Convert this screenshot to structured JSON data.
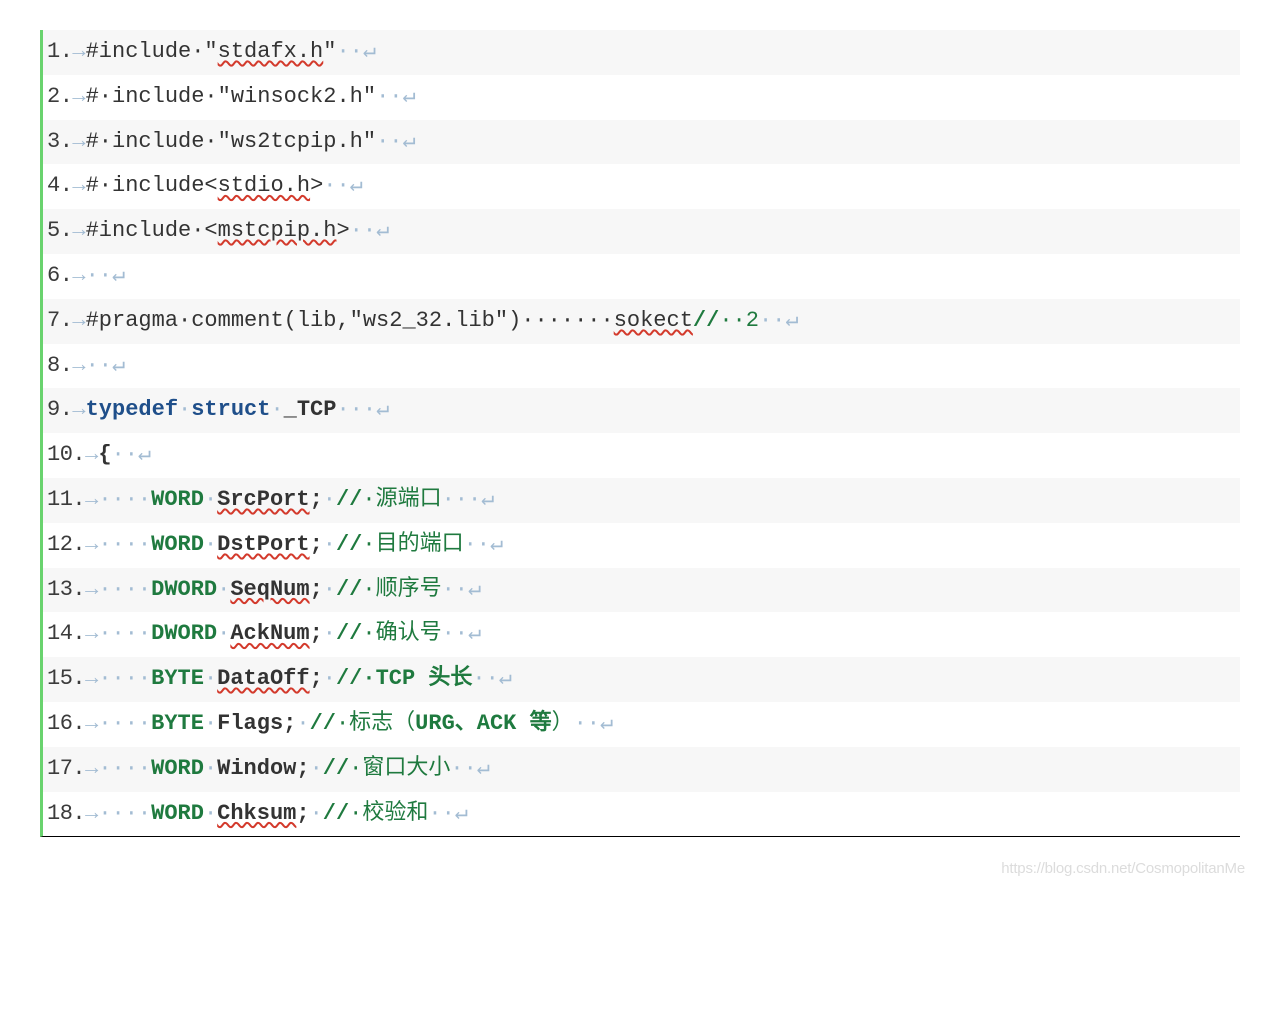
{
  "lines": [
    {
      "n": "1.",
      "tab": "→",
      "pre": "#include·\"",
      "squig": "stdafx.h",
      "post": "\"",
      "trail": "··↵"
    },
    {
      "n": "2.",
      "tab": "→",
      "pre": "#·include·\"winsock2.h\"",
      "trail": "··↵"
    },
    {
      "n": "3.",
      "tab": "→",
      "pre": "#·include·\"ws2tcpip.h\"",
      "trail": "··↵"
    },
    {
      "n": "4.",
      "tab": "→",
      "pre": "#·include<",
      "squig": "stdio.h",
      "post": ">",
      "trail": "··↵"
    },
    {
      "n": "5.",
      "tab": "→",
      "pre": "#include·<",
      "squig": "mstcpip.h",
      "post": ">",
      "trail": "··↵"
    },
    {
      "n": "6.",
      "tab": "→",
      "trail": "··↵"
    },
    {
      "n": "7.",
      "tab": "→",
      "pre": "#pragma·comment(lib,\"ws2_32.lib\")·······",
      "cmt": "//",
      "cmt2": "·",
      "squig": "sokect",
      "post2": "·2",
      "trail": "··↵"
    },
    {
      "n": "8.",
      "tab": "→",
      "trail": "··↵"
    },
    {
      "n": "9.",
      "tab": "→",
      "kw": "typedef",
      "dot1": "·",
      "kw2": "struct",
      "dot2": "·",
      "ident": "_TCP",
      "trail": "··↵"
    },
    {
      "n": "10.",
      "tab": "→",
      "brace": "{",
      "trail": "··↵"
    },
    {
      "n": "11.",
      "tab": "→",
      "dots": "····",
      "type": "WORD",
      "dot1": "·",
      "squig": "SrcPort",
      "semi": ";",
      "dot2": "·",
      "cmt": "//",
      "cmt2": "·源端口",
      "trail": "···↵"
    },
    {
      "n": "12.",
      "tab": "→",
      "dots": "····",
      "type": "WORD",
      "dot1": "·",
      "squig": "DstPort",
      "semi": ";",
      "dot2": "·",
      "cmt": "//",
      "cmt2": "·目的端口",
      "trail": "··↵"
    },
    {
      "n": "13.",
      "tab": "→",
      "dots": "····",
      "type": "DWORD",
      "dot1": "·",
      "squig": "SeqNum",
      "semi": ";",
      "dot2": "·",
      "cmt": "//",
      "cmt2": "·顺序号",
      "trail": "··↵"
    },
    {
      "n": "14.",
      "tab": "→",
      "dots": "····",
      "type": "DWORD",
      "dot1": "·",
      "squig": "AckNum",
      "semi": ";",
      "dot2": "·",
      "cmt": "//",
      "cmt2": "·确认号",
      "trail": "··↵"
    },
    {
      "n": "15.",
      "tab": "→",
      "dots": "····",
      "type": "BYTE",
      "dot1": "·",
      "squig": "DataOff",
      "semi": ";",
      "dot2": "·",
      "cmt": "//",
      "cmtb": "·TCP 头长",
      "trail": "··↵"
    },
    {
      "n": "16.",
      "tab": "→",
      "dots": "····",
      "type": "BYTE",
      "dot1": "·",
      "ident": "Flags;",
      "dot2": "·",
      "cmt": "//",
      "cmt2": "·标志（",
      "cmtb": "URG、ACK 等",
      "cmt3": "）",
      "trail": "··↵"
    },
    {
      "n": "17.",
      "tab": "→",
      "dots": "····",
      "type": "WORD",
      "dot1": "·",
      "ident": "Window;",
      "dot2": "·",
      "cmt": "//",
      "cmt2": "·窗口大小",
      "trail": "··↵"
    },
    {
      "n": "18.",
      "tab": "→",
      "dots": "····",
      "type": "WORD",
      "dot1": "·",
      "squig": "Chksum",
      "semi": ";",
      "dot2": "·",
      "cmt": "//",
      "cmt2": "·校验和",
      "trail": "··↵"
    }
  ],
  "watermark": "https://blog.csdn.net/CosmopolitanMe"
}
